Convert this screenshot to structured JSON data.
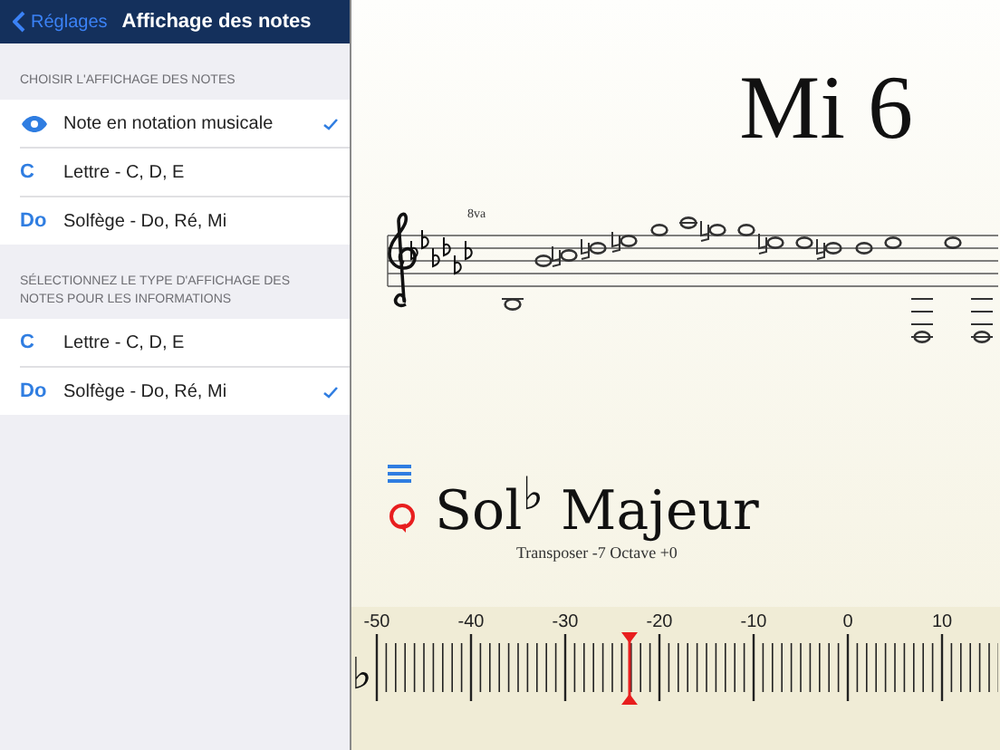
{
  "nav": {
    "back": "Réglages",
    "title": "Affichage des notes"
  },
  "sections": [
    {
      "header": "CHOISIR L'AFFICHAGE DES NOTES",
      "options": [
        {
          "kind": "eye",
          "label": "Note en notation musicale",
          "selected": true
        },
        {
          "kind": "glyph",
          "glyph": "C",
          "label": "Lettre - C, D, E",
          "selected": false
        },
        {
          "kind": "glyph",
          "glyph": "Do",
          "label": "Solfège - Do, Ré, Mi",
          "selected": false
        }
      ]
    },
    {
      "header": "SÉLECTIONNEZ LE TYPE D'AFFICHAGE DES NOTES POUR LES INFORMATIONS",
      "options": [
        {
          "kind": "glyph",
          "glyph": "C",
          "label": "Lettre - C, D, E",
          "selected": false
        },
        {
          "kind": "glyph",
          "glyph": "Do",
          "label": "Solfège - Do, Ré, Mi",
          "selected": true
        }
      ]
    }
  ],
  "note": {
    "name": "Mi 6",
    "octave_mark": "8va"
  },
  "key": {
    "name": "Sol$^{♭}$ Majeur",
    "subtitle": "Transposer -7 Octave +0"
  },
  "tuner": {
    "flat": "♭",
    "labels": [
      "-50",
      "-40",
      "-30",
      "-20",
      "-10",
      "0",
      "10"
    ],
    "level": 0.43
  }
}
